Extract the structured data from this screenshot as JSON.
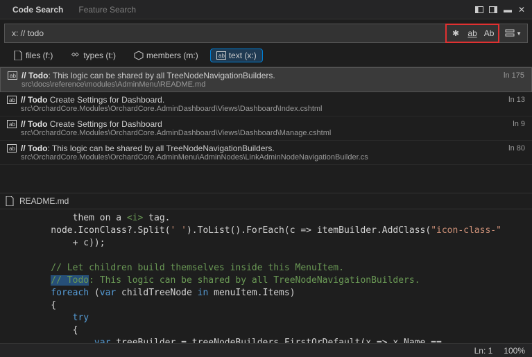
{
  "tabs": {
    "code_search": "Code Search",
    "feature_search": "Feature Search"
  },
  "search": {
    "query": "x: // todo"
  },
  "filters": {
    "files": "files (f:)",
    "types": "types (t:)",
    "members": "members (m:)",
    "text": "text (x:)"
  },
  "opt_buttons": {
    "any": "✱",
    "match_word": "ab",
    "match_case": "Ab"
  },
  "results": [
    {
      "title_prefix": "// Todo",
      "title_rest": ": This logic can be shared by all TreeNodeNavigationBuilders.",
      "path": "src\\docs\\reference\\modules\\AdminMenu\\README.md",
      "line": "ln 175",
      "selected": true
    },
    {
      "title_prefix": "// Todo",
      "title_rest": " Create Settings for Dashboard.",
      "path": "src\\OrchardCore.Modules\\OrchardCore.AdminDashboard\\Views\\Dashboard\\Index.cshtml",
      "line": "ln 13",
      "selected": false
    },
    {
      "title_prefix": "// Todo",
      "title_rest": " Create Settings for Dashboard",
      "path": "src\\OrchardCore.Modules\\OrchardCore.AdminDashboard\\Views\\Dashboard\\Manage.cshtml",
      "line": "ln 9",
      "selected": false
    },
    {
      "title_prefix": "// Todo",
      "title_rest": ": This logic can be shared by all TreeNodeNavigationBuilders.",
      "path": "src\\OrchardCore.Modules\\OrchardCore.AdminMenu\\AdminNodes\\LinkAdminNodeNavigationBuilder.cs",
      "line": "ln 80",
      "selected": false
    }
  ],
  "open_file": "README.md",
  "code_lines": {
    "l1_a": "        them on a ",
    "l1_b": "<i>",
    "l1_c": " tag.",
    "l2_a": "    node.IconClass?.Split(",
    "l2_b": "' '",
    "l2_c": ").ToList().ForEach(c => itemBuilder.AddClass(",
    "l2_d": "\"icon-class-\"",
    "l3": "        + c));",
    "l4": "",
    "l5": "    // Let children build themselves inside this MenuItem.",
    "l6_a": "    ",
    "l6_b": "// Todo",
    "l6_c": ": This logic can be shared by all TreeNodeNavigationBuilders.",
    "l7_a": "    foreach",
    "l7_b": " (",
    "l7_c": "var",
    "l7_d": " childTreeNode ",
    "l7_e": "in",
    "l7_f": " menuItem.Items)",
    "l8": "    {",
    "l9_a": "        try",
    "l10": "        {",
    "l11_a": "            var",
    "l11_b": " treeBuilder = treeNodeBuilders.FirstOrDefault(x => x.Name =="
  },
  "statusbar": {
    "pos": "Ln: 1",
    "zoom": "100%"
  }
}
